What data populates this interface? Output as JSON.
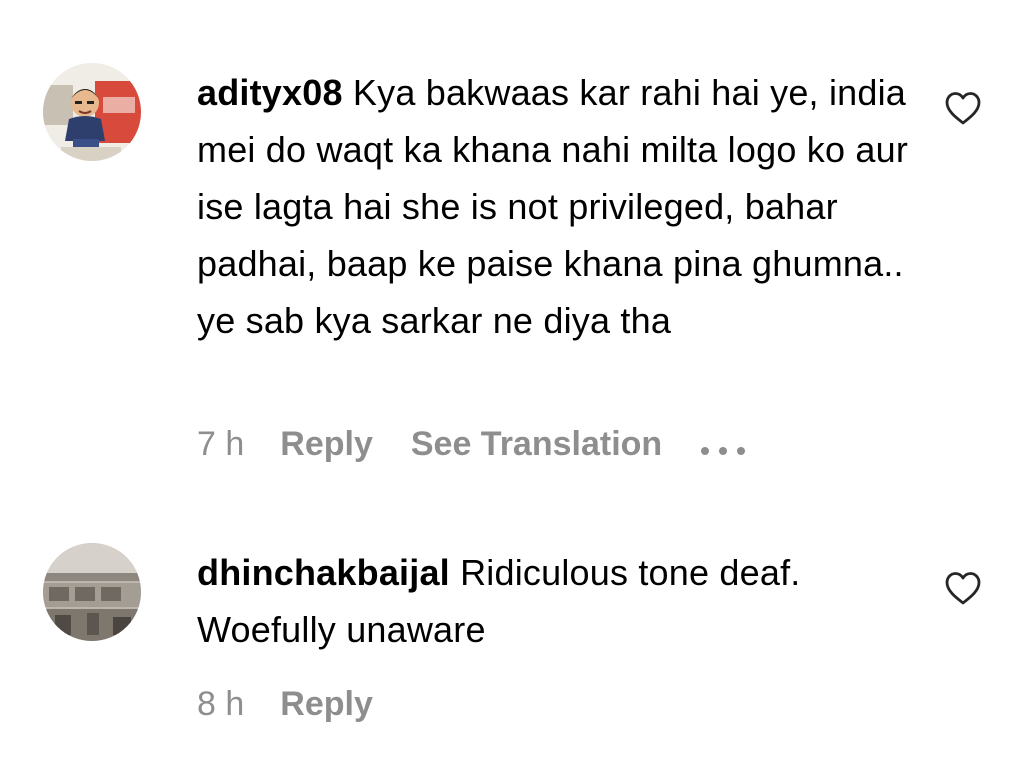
{
  "comments": [
    {
      "username": "adityx08",
      "text": "Kya bakwaas kar rahi hai ye, india mei do waqt ka khana nahi milta logo ko aur ise lagta hai she is not privileged, bahar padhai, baap ke paise khana pina ghumna.. ye sab kya sarkar ne diya tha",
      "time": "7 h",
      "reply_label": "Reply",
      "translate_label": "See Translation",
      "avatar_icon": "cartoon-avatar",
      "like_icon": "heart-outline-icon"
    },
    {
      "username": "dhinchakbaijal",
      "text": "Ridiculous tone deaf. Woefully unaware",
      "time": "8 h",
      "reply_label": "Reply",
      "avatar_icon": "building-photo-avatar",
      "like_icon": "heart-outline-icon"
    }
  ],
  "colors": {
    "meta_text": "#8e8e8e",
    "body_text": "#000000",
    "background": "#ffffff"
  }
}
